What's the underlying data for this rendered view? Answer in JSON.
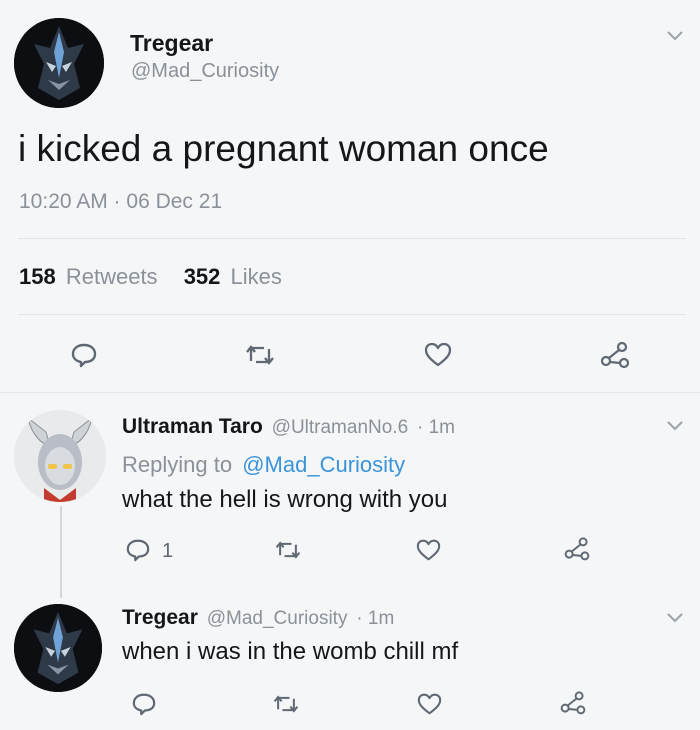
{
  "main_tweet": {
    "author_name": "Tregear",
    "author_handle": "@Mad_Curiosity",
    "text": "i kicked a pregnant woman once",
    "timestamp": "10:20 AM · 06 Dec 21",
    "retweet_count": "158",
    "retweet_label": "Retweets",
    "like_count": "352",
    "like_label": "Likes"
  },
  "replies": [
    {
      "author_name": "Ultraman Taro",
      "author_handle": "@UltramanNo.6",
      "time": "· 1m",
      "replying_prefix": "Replying to",
      "replying_to": "@Mad_Curiosity",
      "text": "what the hell is wrong with you",
      "reply_count": "1"
    },
    {
      "author_name": "Tregear",
      "author_handle": "@Mad_Curiosity",
      "time": "· 1m",
      "text": "when i was in the womb chill mf"
    }
  ],
  "icons": {
    "reply": "reply-icon",
    "retweet": "retweet-icon",
    "like": "heart-icon",
    "share": "share-icon",
    "menu": "chevron-down-icon"
  },
  "colors": {
    "background": "#f5f6f7",
    "text": "#14171a",
    "muted": "#8a9199",
    "link": "#3b94d9",
    "divider": "#e3e6e9"
  }
}
